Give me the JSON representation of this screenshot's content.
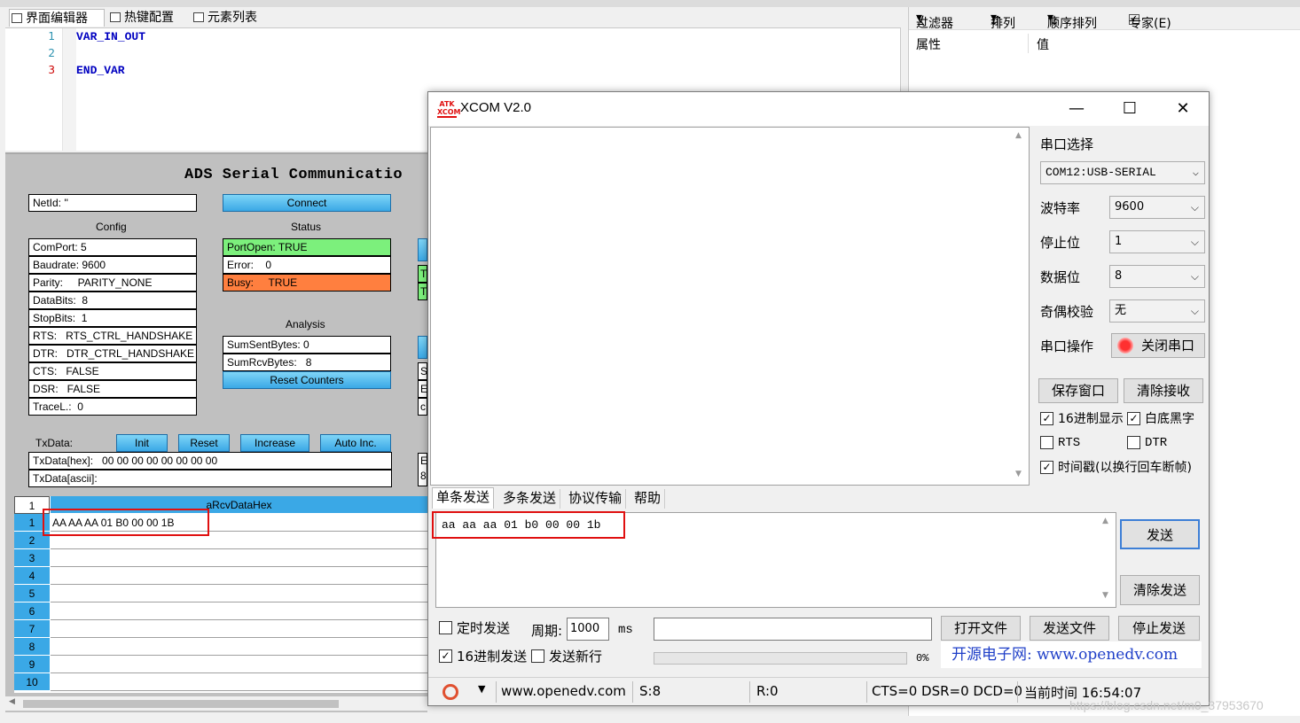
{
  "editor": {
    "tabs": [
      "界面编辑器",
      "热键配置",
      "元素列表"
    ],
    "line_numbers": [
      "1",
      "2",
      "3"
    ],
    "code": [
      "VAR_IN_OUT",
      "",
      "END_VAR"
    ]
  },
  "visu": {
    "title": "ADS Serial Communicatio",
    "netid": "NetId: ''",
    "connect_label": "Connect",
    "config_label": "Config",
    "status_label": "Status",
    "analysis_label": "Analysis",
    "config_fields": [
      "ComPort: 5",
      "Baudrate: 9600",
      "Parity:     PARITY_NONE",
      "DataBits:  8",
      "StopBits:  1",
      "RTS:   RTS_CTRL_HANDSHAKE",
      "DTR:   DTR_CTRL_HANDSHAKE",
      "CTS:   FALSE",
      "DSR:   FALSE",
      "TraceL.:  0"
    ],
    "status_fields": [
      "PortOpen: TRUE",
      "Error:    0",
      "Busy:     TRUE"
    ],
    "analysis_fields": [
      "SumSentBytes: 0",
      "SumRcvBytes:   8"
    ],
    "reset_counters_label": "Reset Counters",
    "txdata_label": "TxData:",
    "tx_buttons": [
      "Init",
      "Reset",
      "Increase",
      "Auto Inc."
    ],
    "txdata_hex": "TxData[hex]:   00 00 00 00 00 00 00 00",
    "txdata_ascii": "TxData[ascii]:",
    "partial_labels": [
      "T",
      "T",
      "S",
      "E",
      "c",
      "E",
      "8"
    ],
    "grid": {
      "corner": "1",
      "header": "aRcvDataHex",
      "row_numbers": [
        "1",
        "2",
        "3",
        "4",
        "5",
        "6",
        "7",
        "8",
        "9",
        "10"
      ],
      "rows": [
        "AA AA AA 01 B0 00 00 1B",
        "",
        "",
        "",
        "",
        "",
        "",
        "",
        "",
        ""
      ]
    }
  },
  "props": {
    "toolbar": [
      "过滤器",
      "排列",
      "顺序排列",
      "专家(E)"
    ],
    "col_property": "属性",
    "col_value": "值"
  },
  "xcom": {
    "title": "XCOM V2.0",
    "logo": "ATK XCOM",
    "serial_select_label": "串口选择",
    "port": "COM12:USB-SERIAL",
    "baud_label": "波特率",
    "baud": "9600",
    "stopbits_label": "停止位",
    "stopbits": "1",
    "databits_label": "数据位",
    "databits": "8",
    "parity_label": "奇偶校验",
    "parity": "无",
    "serial_op_label": "串口操作",
    "close_port_label": "关闭串口",
    "save_window_label": "保存窗口",
    "clear_receive_label": "清除接收",
    "hex_display_label": "16进制显示",
    "white_bg_label": "白底黑字",
    "rts_label": "RTS",
    "dtr_label": "DTR",
    "timestamp_label": "时间戳(以换行回车断帧)",
    "tabs": [
      "单条发送",
      "多条发送",
      "协议传输",
      "帮助"
    ],
    "send_text": "aa aa aa 01 b0 00 00 1b",
    "send_label": "发送",
    "clear_send_label": "清除发送",
    "timed_send_label": "定时发送",
    "period_label": "周期:",
    "period_value": "1000",
    "ms_label": "ms",
    "open_file_label": "打开文件",
    "send_file_label": "发送文件",
    "stop_send_label": "停止发送",
    "hex_send_label": "16进制发送",
    "send_newline_label": "发送新行",
    "progress_text": "0%",
    "progress_value": 0,
    "promo": "开源电子网: www.openedv.com",
    "status": {
      "url": "www.openedv.com",
      "sent": "S:8",
      "recv": "R:0",
      "lines": "CTS=0 DSR=0 DCD=0",
      "time": "当前时间 16:54:07"
    }
  },
  "watermark": "https://blog.csdn.net/m0_37953670",
  "colors": {
    "accent_blue": "#3aa8e6",
    "status_green": "#7cf07c",
    "status_orange": "#ff7f3f",
    "highlight_red": "#e01010"
  }
}
